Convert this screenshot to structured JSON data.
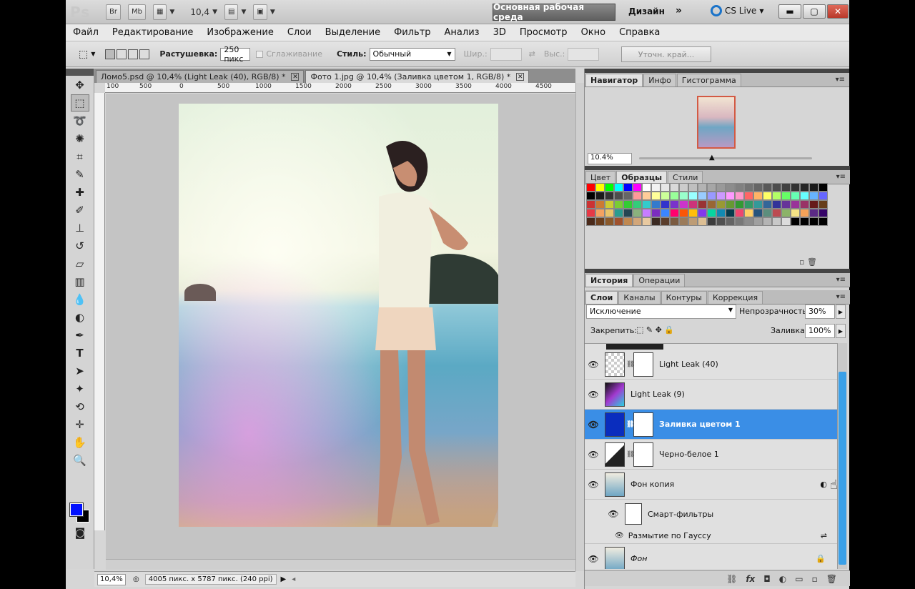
{
  "app": {
    "logo": "Ps",
    "bridge_label": "Br",
    "minibridge_label": "Mb",
    "zoom_value": "10,4",
    "workspace_active": "Основная рабочая среда",
    "workspace_design": "Дизайн",
    "workspace_more": "»",
    "cslive": "CS Live"
  },
  "menu": [
    "Файл",
    "Редактирование",
    "Изображение",
    "Слои",
    "Выделение",
    "Фильтр",
    "Анализ",
    "3D",
    "Просмотр",
    "Окно",
    "Справка"
  ],
  "options": {
    "feather_label": "Растушевка:",
    "feather_value": "250 пикс",
    "antialias_label": "Сглаживание",
    "style_label": "Стиль:",
    "style_value": "Обычный",
    "width_label": "Шир.:",
    "height_label": "Выс.:",
    "refine_label": "Уточн. край..."
  },
  "documents": [
    {
      "title": "Ломо5.psd @ 10,4% (Light Leak (40), RGB/8) *"
    },
    {
      "title": "Фото 1.jpg @ 10,4% (Заливка цветом 1, RGB/8) *"
    }
  ],
  "ruler": [
    "100",
    "500",
    "0",
    "500",
    "1000",
    "1500",
    "2000",
    "2500",
    "3000",
    "3500",
    "4000",
    "4500"
  ],
  "status": {
    "zoom": "10,4%",
    "info": "4005 пикс. x 5787 пикс. (240 ppi)"
  },
  "colors": {
    "foreground": "#0010ff",
    "background": "#000000"
  },
  "navigator": {
    "tabs": [
      "Навигатор",
      "Инфо",
      "Гистограмма"
    ],
    "zoom": "10.4%"
  },
  "swatches_panel": {
    "tabs": [
      "Цвет",
      "Образцы",
      "Стили"
    ],
    "colors": [
      "#ff0000",
      "#ffff00",
      "#00ff00",
      "#00ffff",
      "#0000ff",
      "#ff00ff",
      "#ffffff",
      "#f2f2f2",
      "#e6e6e6",
      "#d9d9d9",
      "#cccccc",
      "#bfbfbf",
      "#b3b3b3",
      "#a6a6a6",
      "#999999",
      "#8c8c8c",
      "#808080",
      "#737373",
      "#666666",
      "#595959",
      "#4d4d4d",
      "#404040",
      "#333333",
      "#262626",
      "#1a1a1a",
      "#000000",
      "#000000",
      "#1a1a1a",
      "#333333",
      "#4d4d4d",
      "#666666",
      "#ff9999",
      "#ffcc99",
      "#ffff99",
      "#ccff99",
      "#99ff99",
      "#99ffcc",
      "#99ffff",
      "#99ccff",
      "#9999ff",
      "#cc99ff",
      "#ff99ff",
      "#ff99cc",
      "#ff6666",
      "#ffb366",
      "#ffff66",
      "#b3ff66",
      "#66ff66",
      "#66ffb3",
      "#66ffff",
      "#66b3ff",
      "#6666ff",
      "#cc3333",
      "#cc7a33",
      "#cccc33",
      "#7acc33",
      "#33cc33",
      "#33cc7a",
      "#33cccc",
      "#337acc",
      "#3333cc",
      "#7a33cc",
      "#cc33cc",
      "#cc337a",
      "#993333",
      "#996633",
      "#999933",
      "#669933",
      "#339933",
      "#339966",
      "#339999",
      "#336699",
      "#333399",
      "#663399",
      "#993399",
      "#993366",
      "#661a1a",
      "#663d1a",
      "#e63946",
      "#f4a261",
      "#e9c46a",
      "#2a9d8f",
      "#264653",
      "#8ab17d",
      "#c77dff",
      "#7b2cbf",
      "#3a86ff",
      "#ff006e",
      "#fb5607",
      "#ffbe0b",
      "#8338ec",
      "#06d6a0",
      "#118ab2",
      "#073b4c",
      "#ef476f",
      "#ffd166",
      "#26547c",
      "#5b8e7d",
      "#bc4b51",
      "#8cb369",
      "#f4e285",
      "#f4a259",
      "#5b2a86",
      "#360568",
      "#4a2a1a",
      "#6b3f1d",
      "#8b5a2b",
      "#a0522d",
      "#c08850",
      "#d2a679",
      "#e8c9a0",
      "#3b2a22",
      "#5a3d2b",
      "#7a5a40",
      "#9b7b5a",
      "#bd9c75",
      "#ddbf94",
      "#3c3c3c",
      "#505050",
      "#646464",
      "#787878",
      "#8c8c8c",
      "#a0a0a0",
      "#b4b4b4",
      "#c8c8c8",
      "#dcdcdc",
      "#000000",
      "#000000",
      "#000000",
      "#000000"
    ]
  },
  "history": {
    "tabs": [
      "История",
      "Операции"
    ]
  },
  "layers_panel": {
    "tabs": [
      "Слои",
      "Каналы",
      "Контуры",
      "Коррекция"
    ],
    "blend_mode": "Исключение",
    "opacity_label": "Непрозрачность:",
    "opacity_value": "30%",
    "lock_label": "Закрепить:",
    "fill_label": "Заливка:",
    "fill_value": "100%",
    "layers": [
      {
        "name": "Light Leak (40)"
      },
      {
        "name": "Light Leak (9)"
      },
      {
        "name": "Заливка цветом 1"
      },
      {
        "name": "Черно-белое 1"
      },
      {
        "name": "Фон копия"
      },
      {
        "name": "Смарт-фильтры"
      },
      {
        "name": "Размытие по Гауссу"
      },
      {
        "name": "Фон"
      }
    ]
  }
}
